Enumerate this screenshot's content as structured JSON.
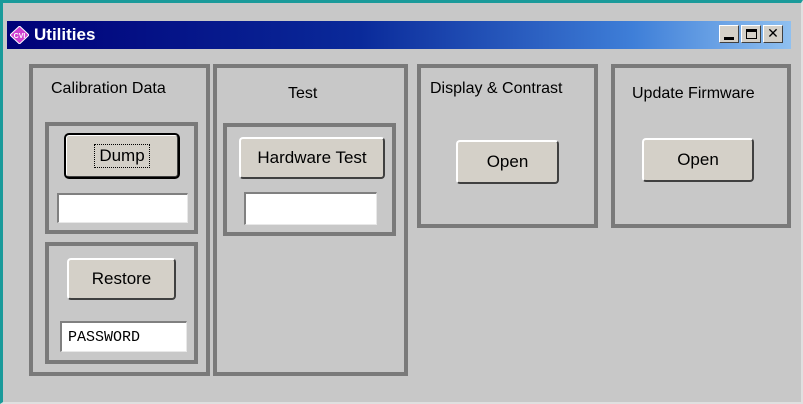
{
  "window": {
    "title": "Utilities",
    "app_icon": "cvi-icon",
    "title_colors": [
      "#000078",
      "#8fc0f0"
    ]
  },
  "controls": {
    "minimize": "minimize-icon",
    "maximize": "maximize-icon",
    "close_glyph": "✕"
  },
  "calibration": {
    "label": "Calibration Data",
    "dump_button": "Dump",
    "dump_field": "",
    "restore_button": "Restore",
    "password_value": "PASSWORD"
  },
  "test": {
    "label": "Test",
    "hardware_button": "Hardware Test",
    "hardware_field": ""
  },
  "display": {
    "label": "Display & Contrast",
    "open_button": "Open"
  },
  "firmware": {
    "label": "Update Firmware",
    "open_button": "Open"
  }
}
